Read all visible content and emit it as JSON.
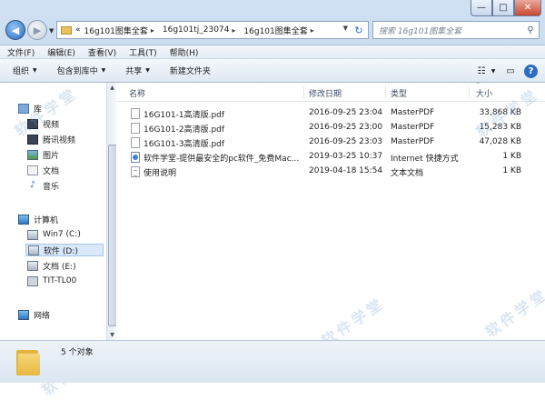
{
  "window": {
    "min_glyph": "—",
    "max_glyph": "□",
    "close_glyph": "✕"
  },
  "address": {
    "prefix": "«",
    "crumbs": [
      "16g101图集全套",
      "16g101tj_23074",
      "16g101图集全套"
    ]
  },
  "search": {
    "placeholder": "搜索 16g101图集全套"
  },
  "menu": [
    "文件(F)",
    "编辑(E)",
    "查看(V)",
    "工具(T)",
    "帮助(H)"
  ],
  "toolbar": [
    "组织",
    "包含到库中",
    "共享",
    "新建文件夹"
  ],
  "navigation": {
    "libraries": {
      "label": "库",
      "items": [
        "视频",
        "腾讯视频",
        "图片",
        "文档",
        "音乐"
      ]
    },
    "computer": {
      "label": "计算机",
      "items": [
        "Win7 (C:)",
        "软件 (D:)",
        "文档 (E:)",
        "TIT-TL00"
      ]
    },
    "network": {
      "label": "网络"
    }
  },
  "columns": {
    "name": "名称",
    "date": "修改日期",
    "type": "类型",
    "size": "大小"
  },
  "files": [
    {
      "name": "16G101-1高清版.pdf",
      "date": "2016-09-25 23:04",
      "type": "MasterPDF",
      "size": "33,868 KB",
      "icon": "pdf-file-icon"
    },
    {
      "name": "16G101-2高清版.pdf",
      "date": "2016-09-25 23:00",
      "type": "MasterPDF",
      "size": "15,283 KB",
      "icon": "pdf-file-icon"
    },
    {
      "name": "16G101-3高清版.pdf",
      "date": "2016-09-25 23:03",
      "type": "MasterPDF",
      "size": "47,028 KB",
      "icon": "pdf-file-icon"
    },
    {
      "name": "软件学堂-提供最安全的pc软件_免费Mac...",
      "date": "2019-03-25 10:37",
      "type": "Internet 快捷方式",
      "size": "1 KB",
      "icon": "internet-shortcut-icon"
    },
    {
      "name": "使用说明",
      "date": "2019-04-18 15:54",
      "type": "文本文档",
      "size": "1 KB",
      "icon": "text-file-icon"
    }
  ],
  "status": {
    "count": "5 个对象"
  },
  "watermark": "软件学堂",
  "colors": {
    "accent": "#2d6cc0",
    "titlebar": "#cfe0f2",
    "selection_drive": "#d9e8fb"
  }
}
